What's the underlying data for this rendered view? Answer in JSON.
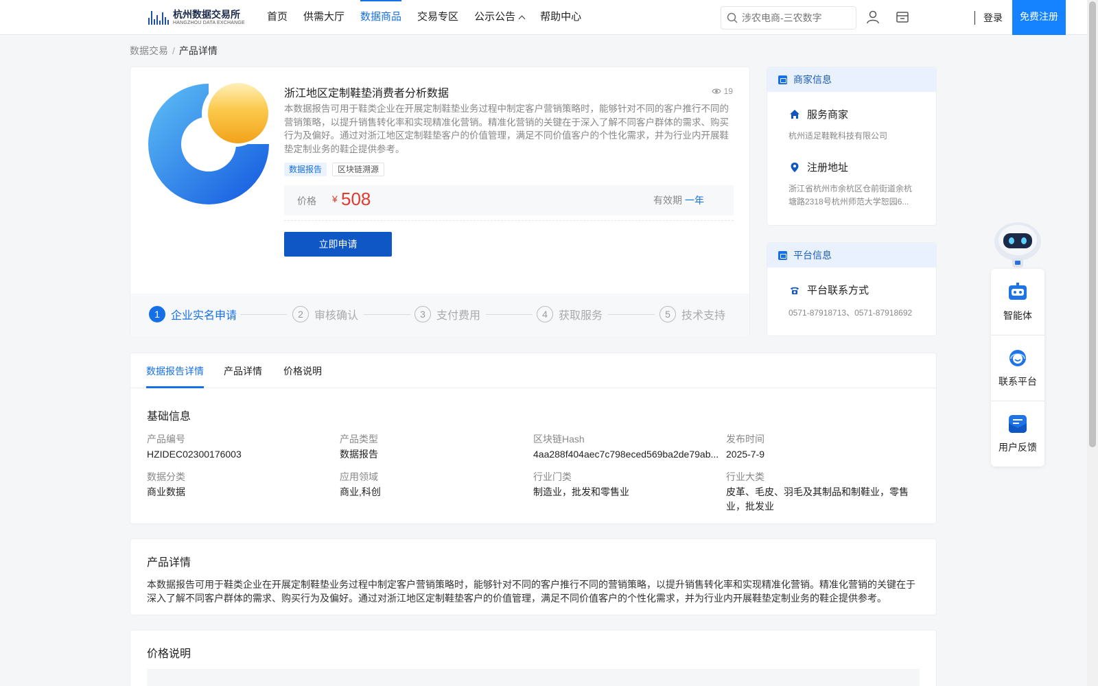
{
  "header": {
    "logo_cn": "杭州数据交易所",
    "logo_en": "HANGZHOU DATA EXCHANGE",
    "nav": [
      {
        "label": "首页",
        "active": false
      },
      {
        "label": "供需大厅",
        "active": false
      },
      {
        "label": "数据商品",
        "active": true
      },
      {
        "label": "交易专区",
        "active": false
      },
      {
        "label": "公示公告",
        "active": false,
        "dropdown": true
      },
      {
        "label": "帮助中心",
        "active": false
      }
    ],
    "search_placeholder": "涉农电商-三农数字",
    "login": "登录",
    "register": "免费注册"
  },
  "breadcrumb": {
    "parent": "数据交易",
    "separator": "/",
    "current": "产品详情"
  },
  "product": {
    "title": "浙江地区定制鞋垫消费者分析数据",
    "views": "19",
    "description": "本数据报告可用于鞋类企业在开展定制鞋垫业务过程中制定客户营销策略时，能够针对不同的客户推行不同的营销策略，以提升销售转化率和实现精准化营销。精准化营销的关键在于深入了解不同客户群体的需求、购买行为及偏好。通过对浙江地区定制鞋垫客户的价值管理，满足不同价值客户的个性化需求，并为行业内开展鞋垫定制业务的鞋企提供参考。",
    "tags": [
      "数据报告",
      "区块链溯源"
    ],
    "price_label": "价格",
    "price_symbol": "¥",
    "price_value": "508",
    "validity_label": "有效期",
    "validity_value": "一年",
    "apply_button": "立即申请",
    "steps": [
      {
        "num": "1",
        "label": "企业实名申请"
      },
      {
        "num": "2",
        "label": "审核确认"
      },
      {
        "num": "3",
        "label": "支付费用"
      },
      {
        "num": "4",
        "label": "获取服务"
      },
      {
        "num": "5",
        "label": "技术支持"
      }
    ],
    "active_step": 1
  },
  "merchant": {
    "title": "商家信息",
    "service_label": "服务商家",
    "service_value": "杭州适足鞋靴科技有限公司",
    "address_label": "注册地址",
    "address_value": "浙江省杭州市余杭区仓前街道余杭塘路2318号杭州师范大学恕园6..."
  },
  "platform": {
    "title": "平台信息",
    "contact_label": "平台联系方式",
    "contact_value": "0571-87918713、0571-87918692"
  },
  "float_tools": [
    {
      "label": "智能体",
      "icon": "robot-icon"
    },
    {
      "label": "联系平台",
      "icon": "headset-icon"
    },
    {
      "label": "用户反馈",
      "icon": "feedback-icon"
    }
  ],
  "tabs": [
    "数据报告详情",
    "产品详情",
    "价格说明"
  ],
  "basic_info": {
    "title": "基础信息",
    "fields": [
      {
        "key": "产品编号",
        "value": "HZIDEC02300176003"
      },
      {
        "key": "产品类型",
        "value": "数据报告"
      },
      {
        "key": "区块链Hash",
        "value": "4aa288f404aec7c798eced569ba2de79ab..."
      },
      {
        "key": "发布时间",
        "value": "2025-7-9"
      },
      {
        "key": "数据分类",
        "value": "商业数据"
      },
      {
        "key": "应用领域",
        "value": "商业,科创"
      },
      {
        "key": "行业门类",
        "value": "制造业，批发和零售业"
      },
      {
        "key": "行业大类",
        "value": "皮革、毛皮、羽毛及其制品和制鞋业，零售业，批发业"
      }
    ]
  },
  "product_detail": {
    "title": "产品详情",
    "text": "本数据报告可用于鞋类企业在开展定制鞋垫业务过程中制定客户营销策略时，能够针对不同的客户推行不同的营销策略，以提升销售转化率和实现精准化营销。精准化营销的关键在于深入了解不同客户群体的需求、购买行为及偏好。通过对浙江地区定制鞋垫客户的价值管理，满足不同价值客户的个性化需求，并为行业内开展鞋垫定制业务的鞋企提供参考。"
  },
  "price_note": {
    "title": "价格说明"
  },
  "colors": {
    "primary": "#1570e8",
    "button": "#0f57c4",
    "price": "#e33a2f",
    "register": "#1583ff"
  }
}
